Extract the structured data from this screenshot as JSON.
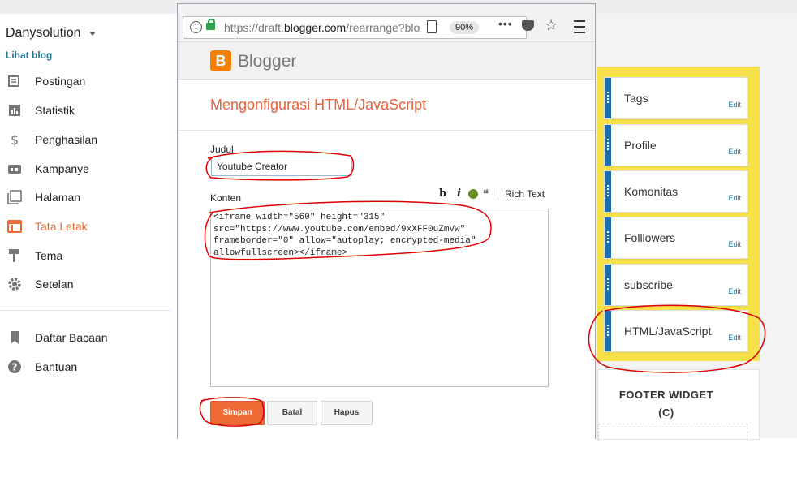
{
  "sidebar": {
    "blog_name": "Danysolution",
    "view_blog": "Lihat blog",
    "items": [
      {
        "label": "Postingan",
        "icon": "posts-icon"
      },
      {
        "label": "Statistik",
        "icon": "stats-icon"
      },
      {
        "label": "Penghasilan",
        "icon": "dollar-icon"
      },
      {
        "label": "Kampanye",
        "icon": "ad-icon"
      },
      {
        "label": "Halaman",
        "icon": "pages-icon"
      },
      {
        "label": "Tata Letak",
        "icon": "layout-icon"
      },
      {
        "label": "Tema",
        "icon": "paint-roller-icon"
      },
      {
        "label": "Setelan",
        "icon": "gear-icon"
      },
      {
        "label": "Daftar Bacaan",
        "icon": "bookmark-icon"
      },
      {
        "label": "Bantuan",
        "icon": "help-icon"
      }
    ],
    "active_index": 5,
    "accent_color": "#f06a35"
  },
  "browser": {
    "url_host": "https://draft.",
    "url_domain": "blogger.com",
    "url_path": "/rearrange?blo",
    "zoom": "90%"
  },
  "blogger": {
    "logo_letter": "B",
    "brand": "Blogger"
  },
  "dialog": {
    "title": "Mengonfigurasi HTML/JavaScript",
    "judul_label": "Judul",
    "judul_value": "Youtube Creator",
    "konten_label": "Konten",
    "rich_text_label": "Rich Text",
    "konten_value": "<iframe width=\"560\" height=\"315\"\nsrc=\"https://www.youtube.com/embed/9xXFF0uZmVw\"\nframeborder=\"0\" allow=\"autoplay; encrypted-media\"\nallowfullscreen></iframe>",
    "save_label": "Simpan",
    "cancel_label": "Batal",
    "delete_label": "Hapus"
  },
  "layout_panel": {
    "widgets": [
      {
        "name": "Tags",
        "edit": "Edit"
      },
      {
        "name": "Profile",
        "edit": "Edit"
      },
      {
        "name": "Komonitas",
        "edit": "Edit"
      },
      {
        "name": "Folllowers",
        "edit": "Edit"
      },
      {
        "name": "subscribe",
        "edit": "Edit"
      },
      {
        "name": "HTML/JavaScript",
        "edit": "Edit"
      }
    ],
    "footer_title_line1": "FOOTER WIDGET",
    "footer_title_line2": "(C)",
    "section_color": "#f7e14b",
    "handle_color": "#1a6fb3"
  },
  "annotation_color": "#e00000"
}
